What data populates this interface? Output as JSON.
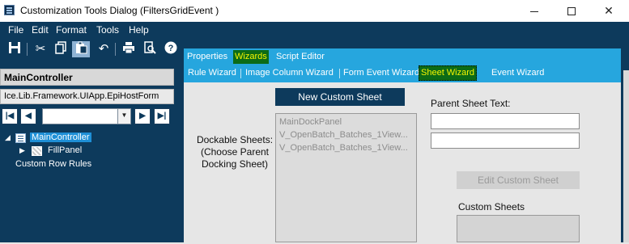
{
  "window": {
    "title": "Customization Tools Dialog  (FiltersGridEvent )",
    "minimize": "minimize",
    "maximize": "maximize",
    "close": "✕"
  },
  "menu": [
    "File",
    "Edit",
    "Format",
    "Tools",
    "Help"
  ],
  "toolbar": {
    "icons": [
      "save-icon",
      "cut-icon",
      "copy-icon",
      "paste-icon",
      "undo-icon",
      "print-icon",
      "print-preview-icon",
      "help-icon"
    ]
  },
  "left_panel": {
    "header": "MainController",
    "path": "Ice.Lib.Framework.UIApp.EpiHostForm",
    "nav": {
      "first": "|◀",
      "prev": "◀",
      "next": "▶",
      "last": "▶|",
      "combo_value": ""
    },
    "tree": {
      "root": "MainController",
      "child": "FillPanel",
      "extra": "Custom Row Rules"
    }
  },
  "tabs": {
    "row1": [
      "Properties",
      "Wizards",
      "Script Editor"
    ],
    "row1_active": "Wizards",
    "row2": [
      "Rule Wizard",
      "Image Column Wizard",
      "Form Event Wizard",
      "Sheet Wizard",
      "Event Wizard"
    ],
    "row2_active": "Sheet Wizard"
  },
  "sheet_wizard": {
    "new_button": "New Custom Sheet",
    "dockable_label": "Dockable Sheets:\n(Choose Parent\nDocking Sheet)",
    "dockable_label_lines": [
      "Dockable Sheets:",
      "(Choose Parent",
      "Docking Sheet)"
    ],
    "dockable_items": [
      "MainDockPanel",
      "V_OpenBatch_Batches_1View...",
      "V_OpenBatch_Batches_1View..."
    ],
    "parent_sheet_label": "Parent Sheet Text:",
    "parent_sheet_value": "",
    "second_text_value": "",
    "edit_button": "Edit Custom Sheet",
    "custom_sheets_label": "Custom Sheets"
  },
  "colors": {
    "app_bg": "#0d3a5c",
    "tab_strip": "#26a6de",
    "active_tab_bg": "#0c6b16",
    "active_tab_text": "#f5f500",
    "selection": "#1e8fd6"
  }
}
